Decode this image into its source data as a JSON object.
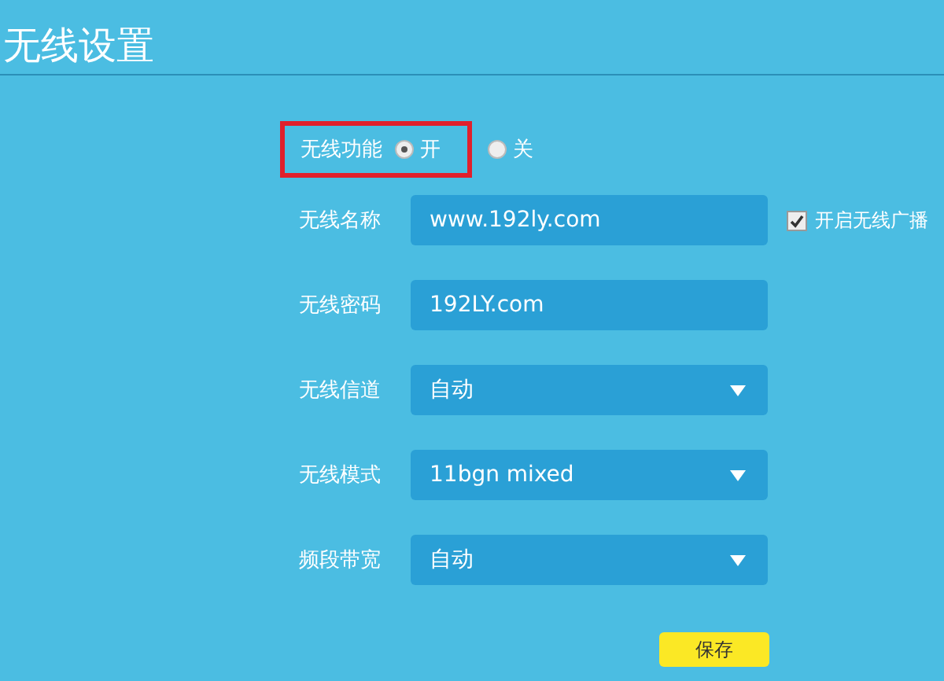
{
  "title": "无线设置",
  "wireless_switch": {
    "label": "无线功能",
    "highlighted": true,
    "options": [
      {
        "label": "开",
        "selected": true
      },
      {
        "label": "关",
        "selected": false
      }
    ]
  },
  "fields": [
    {
      "kind": "text",
      "label": "无线名称",
      "value": "www.192ly.com",
      "checkbox": {
        "label": "开启无线广播",
        "checked": true
      }
    },
    {
      "kind": "text",
      "label": "无线密码",
      "value": "192LY.com"
    },
    {
      "kind": "select",
      "label": "无线信道",
      "value": "自动"
    },
    {
      "kind": "select",
      "label": "无线模式",
      "value": "11bgn mixed"
    },
    {
      "kind": "select",
      "label": "频段带宽",
      "value": "自动"
    }
  ],
  "save_button": "保存"
}
